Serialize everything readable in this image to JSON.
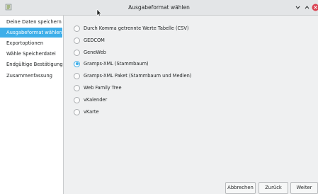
{
  "window": {
    "title": "Ausgabeformat wählen"
  },
  "sidebar": {
    "items": [
      {
        "label": "Deine Daten speichern"
      },
      {
        "label": "Ausgabeformat wählen"
      },
      {
        "label": "Exportoptionen"
      },
      {
        "label": "Wähle Speicherdatei"
      },
      {
        "label": "Endgültige Bestätigung"
      },
      {
        "label": "Zusammenfassung"
      }
    ]
  },
  "formats": [
    {
      "label": "Durch Komma getrennte Werte Tabelle (CSV)",
      "checked": false
    },
    {
      "label": "GEDCOM",
      "checked": false
    },
    {
      "label": "GeneWeb",
      "checked": false
    },
    {
      "label": "Gramps-XML (Stammbaum)",
      "checked": true
    },
    {
      "label": "Gramps-XML Paket (Stammbaum und Medien)",
      "checked": false
    },
    {
      "label": "Web Family Tree",
      "checked": false
    },
    {
      "label": "vKalender",
      "checked": false
    },
    {
      "label": "vKarte",
      "checked": false
    }
  ],
  "buttons": {
    "cancel": "Abbrechen",
    "back": "Zurück",
    "next": "Weiter"
  },
  "colors": {
    "accent": "#3daee9",
    "close": "#da4453"
  }
}
